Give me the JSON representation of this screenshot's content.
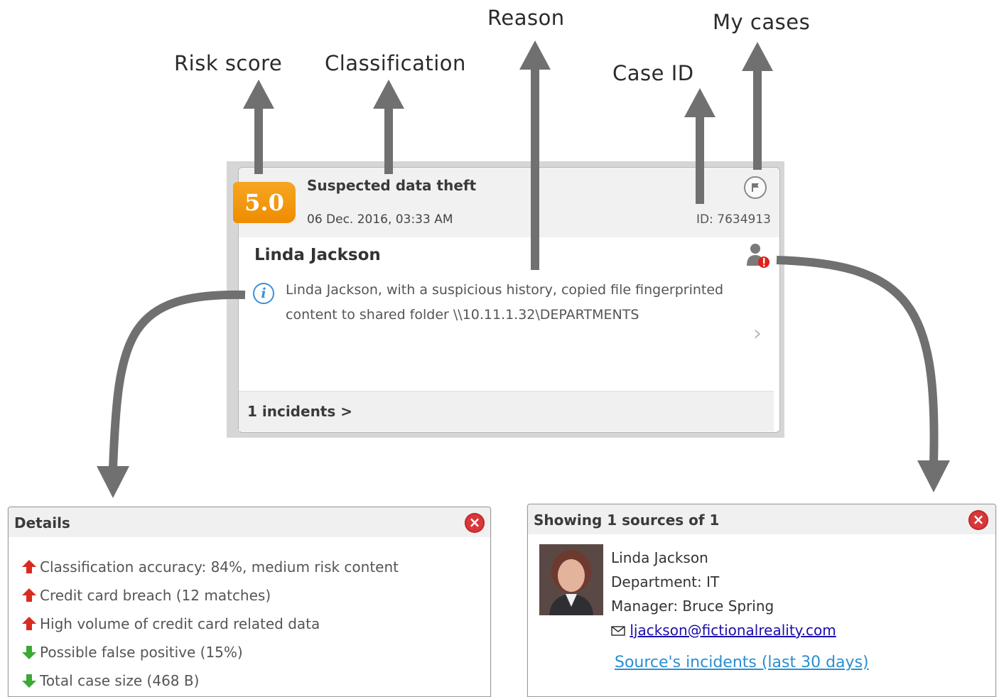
{
  "callouts": {
    "risk_score": "Risk score",
    "classification": "Classification",
    "reason": "Reason",
    "case_id": "Case ID",
    "my_cases": "My cases"
  },
  "case_card": {
    "risk_score": "5.0",
    "classification": "Suspected data theft",
    "timestamp": "06 Dec. 2016, 03:33 AM",
    "case_id": "ID: 7634913",
    "user_name": "Linda Jackson",
    "reason": "Linda Jackson, with a suspicious history, copied file fingerprinted content to shared folder \\\\10.11.1.32\\DEPARTMENTS",
    "incidents_link": "1 incidents >",
    "colors": {
      "badge": "#F39A12",
      "info": "#3D8FD6"
    }
  },
  "details_panel": {
    "title": "Details",
    "items": [
      {
        "text": "Classification accuracy: 84%, medium risk content",
        "direction": "up"
      },
      {
        "text": "Credit card breach (12 matches)",
        "direction": "up"
      },
      {
        "text": "High volume of credit card related data",
        "direction": "up"
      },
      {
        "text": "Possible false positive (15%)",
        "direction": "down"
      },
      {
        "text": "Total case size (468 B)",
        "direction": "down"
      }
    ],
    "colors": {
      "up": "#D92B1F",
      "down": "#3AA935",
      "close": "#D9383A"
    }
  },
  "sources_panel": {
    "title": "Showing 1 sources of 1",
    "name": "Linda Jackson",
    "department": "Department: IT",
    "manager": "Manager: Bruce Spring",
    "email": "ljackson@fictionalreality.com",
    "incidents_link": "Source's incidents (last 30 days)"
  },
  "icons": [
    "flag-icon",
    "user-risk-icon",
    "info-icon",
    "chevron-right-icon",
    "close-icon",
    "mail-icon",
    "arrow-up-icon",
    "arrow-down-icon"
  ]
}
